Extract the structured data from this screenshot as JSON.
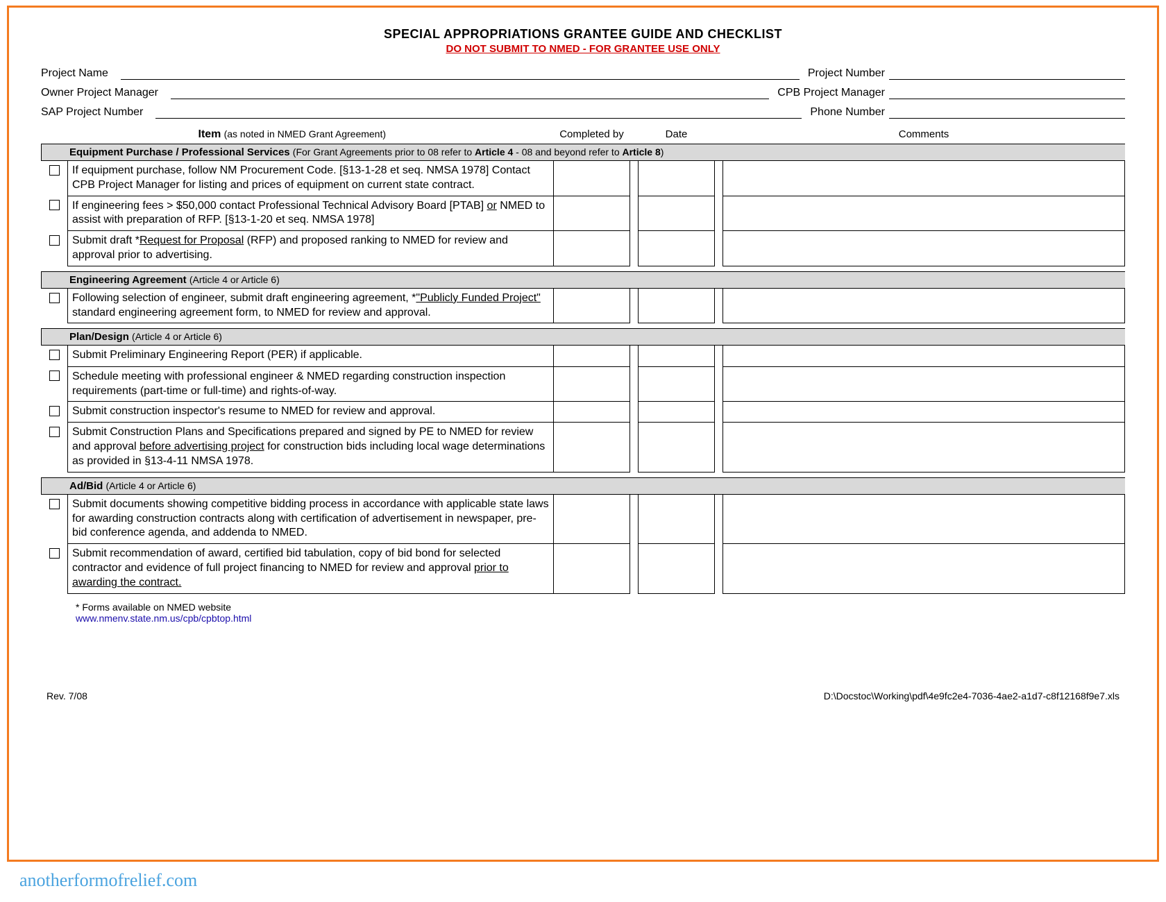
{
  "header": {
    "title": "SPECIAL APPROPRIATIONS GRANTEE GUIDE AND CHECKLIST",
    "subtitle": "DO NOT SUBMIT TO NMED - FOR GRANTEE USE ONLY"
  },
  "form": {
    "project_name_lbl": "Project Name",
    "project_number_lbl": "Project Number",
    "owner_pm_lbl": "Owner Project Manager",
    "cpb_pm_lbl": "CPB Project Manager",
    "sap_number_lbl": "SAP Project Number",
    "phone_lbl": "Phone Number"
  },
  "cols": {
    "item_lbl": "Item",
    "item_note": "(as noted in NMED Grant Agreement)",
    "completed_by": "Completed by",
    "date": "Date",
    "comments": "Comments"
  },
  "sections": [
    {
      "title": "Equipment Purchase / Professional Services",
      "note_pre": "(For Grant Agreements prior to 08 refer to ",
      "note_b1": "Article 4",
      "note_mid": " - 08 and beyond refer to ",
      "note_b2": "Article 8",
      "note_post": ")",
      "items": [
        "If equipment purchase, follow NM Procurement Code. [§13-1-28 et seq. NMSA 1978] Contact CPB Project Manager for listing and prices of equipment on current state contract.",
        "If engineering fees > $50,000 contact Professional Technical Advisory Board [PTAB] __or__ NMED to assist with preparation of RFP. [§13-1-20 et seq. NMSA 1978]",
        "Submit draft *__Request for Proposal__ (RFP) and proposed ranking to NMED for review and approval prior to advertising."
      ]
    },
    {
      "title": "Engineering Agreement",
      "note": "(Article 4 or Article 6)",
      "items": [
        "Following selection of engineer, submit draft engineering agreement, *__\"Publicly Funded Project\"__ standard engineering agreement  form, to NMED for review and approval."
      ]
    },
    {
      "title": "Plan/Design",
      "note": "(Article 4 or Article 6)",
      "items": [
        "Submit Preliminary Engineering Report (PER) if applicable.",
        "Schedule meeting with professional engineer & NMED regarding construction inspection requirements (part-time or full-time) and rights-of-way.",
        "Submit construction inspector's resume to NMED for review and approval.",
        "Submit Construction Plans and Specifications prepared and signed by PE to NMED for review and approval __before advertising project__ for construction bids including local wage determinations as provided in §13-4-11 NMSA 1978."
      ]
    },
    {
      "title": "Ad/Bid",
      "note": "(Article 4 or Article 6)",
      "items": [
        "Submit documents showing competitive bidding process in accordance with applicable state laws for awarding construction contracts along with certification of advertisement in newspaper, pre-bid conference agenda, and addenda to NMED.",
        "Submit recommendation of award, certified bid tabulation, copy of bid bond for selected contractor and evidence of full project financing to NMED for review and approval __prior to awarding the contract.__"
      ]
    }
  ],
  "footer": {
    "forms_note": "*  Forms available on NMED website",
    "link_text": "www.nmenv.state.nm.us/cpb/cpbtop.html",
    "rev": "Rev. 7/08",
    "path": "D:\\Docstoc\\Working\\pdf\\4e9fc2e4-7036-4ae2-a1d7-c8f12168f9e7.xls"
  },
  "watermark": "anotherformofrelief.com"
}
